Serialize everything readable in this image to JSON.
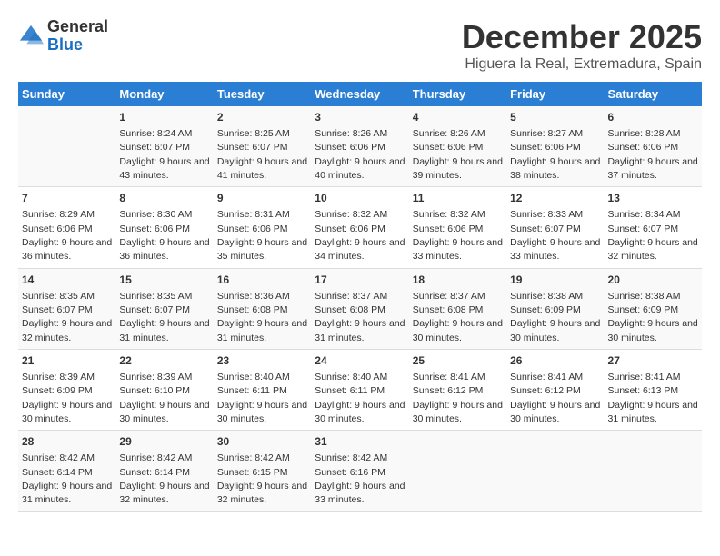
{
  "header": {
    "logo_line1": "General",
    "logo_line2": "Blue",
    "title": "December 2025",
    "subtitle": "Higuera la Real, Extremadura, Spain"
  },
  "days_header": [
    "Sunday",
    "Monday",
    "Tuesday",
    "Wednesday",
    "Thursday",
    "Friday",
    "Saturday"
  ],
  "weeks": [
    [
      {
        "num": "",
        "sunrise": "",
        "sunset": "",
        "daylight": ""
      },
      {
        "num": "1",
        "sunrise": "Sunrise: 8:24 AM",
        "sunset": "Sunset: 6:07 PM",
        "daylight": "Daylight: 9 hours and 43 minutes."
      },
      {
        "num": "2",
        "sunrise": "Sunrise: 8:25 AM",
        "sunset": "Sunset: 6:07 PM",
        "daylight": "Daylight: 9 hours and 41 minutes."
      },
      {
        "num": "3",
        "sunrise": "Sunrise: 8:26 AM",
        "sunset": "Sunset: 6:06 PM",
        "daylight": "Daylight: 9 hours and 40 minutes."
      },
      {
        "num": "4",
        "sunrise": "Sunrise: 8:26 AM",
        "sunset": "Sunset: 6:06 PM",
        "daylight": "Daylight: 9 hours and 39 minutes."
      },
      {
        "num": "5",
        "sunrise": "Sunrise: 8:27 AM",
        "sunset": "Sunset: 6:06 PM",
        "daylight": "Daylight: 9 hours and 38 minutes."
      },
      {
        "num": "6",
        "sunrise": "Sunrise: 8:28 AM",
        "sunset": "Sunset: 6:06 PM",
        "daylight": "Daylight: 9 hours and 37 minutes."
      }
    ],
    [
      {
        "num": "7",
        "sunrise": "Sunrise: 8:29 AM",
        "sunset": "Sunset: 6:06 PM",
        "daylight": "Daylight: 9 hours and 36 minutes."
      },
      {
        "num": "8",
        "sunrise": "Sunrise: 8:30 AM",
        "sunset": "Sunset: 6:06 PM",
        "daylight": "Daylight: 9 hours and 36 minutes."
      },
      {
        "num": "9",
        "sunrise": "Sunrise: 8:31 AM",
        "sunset": "Sunset: 6:06 PM",
        "daylight": "Daylight: 9 hours and 35 minutes."
      },
      {
        "num": "10",
        "sunrise": "Sunrise: 8:32 AM",
        "sunset": "Sunset: 6:06 PM",
        "daylight": "Daylight: 9 hours and 34 minutes."
      },
      {
        "num": "11",
        "sunrise": "Sunrise: 8:32 AM",
        "sunset": "Sunset: 6:06 PM",
        "daylight": "Daylight: 9 hours and 33 minutes."
      },
      {
        "num": "12",
        "sunrise": "Sunrise: 8:33 AM",
        "sunset": "Sunset: 6:07 PM",
        "daylight": "Daylight: 9 hours and 33 minutes."
      },
      {
        "num": "13",
        "sunrise": "Sunrise: 8:34 AM",
        "sunset": "Sunset: 6:07 PM",
        "daylight": "Daylight: 9 hours and 32 minutes."
      }
    ],
    [
      {
        "num": "14",
        "sunrise": "Sunrise: 8:35 AM",
        "sunset": "Sunset: 6:07 PM",
        "daylight": "Daylight: 9 hours and 32 minutes."
      },
      {
        "num": "15",
        "sunrise": "Sunrise: 8:35 AM",
        "sunset": "Sunset: 6:07 PM",
        "daylight": "Daylight: 9 hours and 31 minutes."
      },
      {
        "num": "16",
        "sunrise": "Sunrise: 8:36 AM",
        "sunset": "Sunset: 6:08 PM",
        "daylight": "Daylight: 9 hours and 31 minutes."
      },
      {
        "num": "17",
        "sunrise": "Sunrise: 8:37 AM",
        "sunset": "Sunset: 6:08 PM",
        "daylight": "Daylight: 9 hours and 31 minutes."
      },
      {
        "num": "18",
        "sunrise": "Sunrise: 8:37 AM",
        "sunset": "Sunset: 6:08 PM",
        "daylight": "Daylight: 9 hours and 30 minutes."
      },
      {
        "num": "19",
        "sunrise": "Sunrise: 8:38 AM",
        "sunset": "Sunset: 6:09 PM",
        "daylight": "Daylight: 9 hours and 30 minutes."
      },
      {
        "num": "20",
        "sunrise": "Sunrise: 8:38 AM",
        "sunset": "Sunset: 6:09 PM",
        "daylight": "Daylight: 9 hours and 30 minutes."
      }
    ],
    [
      {
        "num": "21",
        "sunrise": "Sunrise: 8:39 AM",
        "sunset": "Sunset: 6:09 PM",
        "daylight": "Daylight: 9 hours and 30 minutes."
      },
      {
        "num": "22",
        "sunrise": "Sunrise: 8:39 AM",
        "sunset": "Sunset: 6:10 PM",
        "daylight": "Daylight: 9 hours and 30 minutes."
      },
      {
        "num": "23",
        "sunrise": "Sunrise: 8:40 AM",
        "sunset": "Sunset: 6:11 PM",
        "daylight": "Daylight: 9 hours and 30 minutes."
      },
      {
        "num": "24",
        "sunrise": "Sunrise: 8:40 AM",
        "sunset": "Sunset: 6:11 PM",
        "daylight": "Daylight: 9 hours and 30 minutes."
      },
      {
        "num": "25",
        "sunrise": "Sunrise: 8:41 AM",
        "sunset": "Sunset: 6:12 PM",
        "daylight": "Daylight: 9 hours and 30 minutes."
      },
      {
        "num": "26",
        "sunrise": "Sunrise: 8:41 AM",
        "sunset": "Sunset: 6:12 PM",
        "daylight": "Daylight: 9 hours and 30 minutes."
      },
      {
        "num": "27",
        "sunrise": "Sunrise: 8:41 AM",
        "sunset": "Sunset: 6:13 PM",
        "daylight": "Daylight: 9 hours and 31 minutes."
      }
    ],
    [
      {
        "num": "28",
        "sunrise": "Sunrise: 8:42 AM",
        "sunset": "Sunset: 6:14 PM",
        "daylight": "Daylight: 9 hours and 31 minutes."
      },
      {
        "num": "29",
        "sunrise": "Sunrise: 8:42 AM",
        "sunset": "Sunset: 6:14 PM",
        "daylight": "Daylight: 9 hours and 32 minutes."
      },
      {
        "num": "30",
        "sunrise": "Sunrise: 8:42 AM",
        "sunset": "Sunset: 6:15 PM",
        "daylight": "Daylight: 9 hours and 32 minutes."
      },
      {
        "num": "31",
        "sunrise": "Sunrise: 8:42 AM",
        "sunset": "Sunset: 6:16 PM",
        "daylight": "Daylight: 9 hours and 33 minutes."
      },
      {
        "num": "",
        "sunrise": "",
        "sunset": "",
        "daylight": ""
      },
      {
        "num": "",
        "sunrise": "",
        "sunset": "",
        "daylight": ""
      },
      {
        "num": "",
        "sunrise": "",
        "sunset": "",
        "daylight": ""
      }
    ]
  ]
}
